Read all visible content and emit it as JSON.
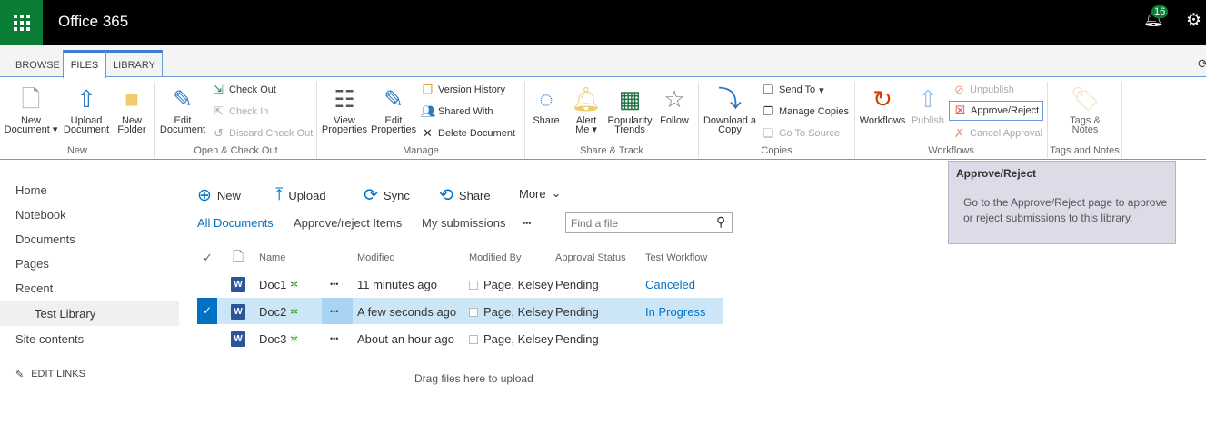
{
  "app": {
    "title": "Office 365",
    "notification_count": "16"
  },
  "tabs": [
    "BROWSE",
    "FILES",
    "LIBRARY"
  ],
  "ribbon": {
    "new": {
      "label": "New",
      "new_document": "New Document",
      "upload_document": "Upload Document",
      "new_folder": "New Folder"
    },
    "open": {
      "label": "Open & Check Out",
      "edit_document": "Edit Document",
      "check_out": "Check Out",
      "check_in": "Check In",
      "discard": "Discard Check Out"
    },
    "manage": {
      "label": "Manage",
      "view_properties": "View Properties",
      "edit_properties": "Edit Properties",
      "version_history": "Version History",
      "shared_with": "Shared With",
      "delete_document": "Delete Document"
    },
    "share": {
      "label": "Share & Track",
      "share": "Share",
      "alert_me": "Alert Me",
      "popularity": "Popularity Trends",
      "follow": "Follow"
    },
    "copies": {
      "label": "Copies",
      "download": "Download a Copy",
      "send_to": "Send To",
      "manage_copies": "Manage Copies",
      "go_to_source": "Go To Source"
    },
    "workflows": {
      "label": "Workflows",
      "workflows": "Workflows",
      "publish": "Publish",
      "unpublish": "Unpublish",
      "approve_reject": "Approve/Reject",
      "cancel_approval": "Cancel Approval"
    },
    "tags": {
      "label": "Tags and Notes",
      "tags_notes": "Tags & Notes"
    }
  },
  "tooltip": {
    "title": "Approve/Reject",
    "body": "Go to the Approve/Reject page to approve or reject submissions to this library."
  },
  "nav": {
    "items": [
      "Home",
      "Notebook",
      "Documents",
      "Pages",
      "Recent",
      "Test Library",
      "Site contents"
    ],
    "edit_links": "EDIT LINKS"
  },
  "commands": {
    "new": "New",
    "upload": "Upload",
    "sync": "Sync",
    "share": "Share",
    "more": "More"
  },
  "views": {
    "all": "All Documents",
    "approve": "Approve/reject Items",
    "mine": "My submissions",
    "ellipsis": "•••"
  },
  "search": {
    "placeholder": "Find a file"
  },
  "columns": [
    "Name",
    "Modified",
    "Modified By",
    "Approval Status",
    "Test Workflow"
  ],
  "rows": [
    {
      "name": "Doc1",
      "modified": "11 minutes ago",
      "by": "Page, Kelsey",
      "status": "Pending",
      "workflow": "Canceled",
      "selected": false
    },
    {
      "name": "Doc2",
      "modified": "A few seconds ago",
      "by": "Page, Kelsey",
      "status": "Pending",
      "workflow": "In Progress",
      "selected": true
    },
    {
      "name": "Doc3",
      "modified": "About an hour ago",
      "by": "Page, Kelsey",
      "status": "Pending",
      "workflow": "",
      "selected": false
    }
  ],
  "drop_hint": "Drag files here to upload",
  "colors": {
    "brand": "#0a7d35",
    "accent": "#0072c6",
    "selected_row": "#cde6f7"
  }
}
